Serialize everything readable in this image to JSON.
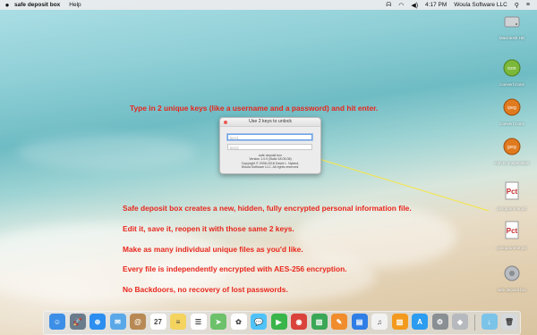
{
  "menubar": {
    "app_name": "safe deposit box",
    "menus": [
      "Help"
    ],
    "time": "4:17 PM",
    "company": "Woula Software LLC"
  },
  "instructions": {
    "top": "Type in 2 unique keys (like a username and a password) and hit enter.",
    "lines": [
      "Safe deposit box creates a new, hidden, fully encrypted personal information file.",
      "Edit it, save it, reopen it with those same 2 keys.",
      "Make as many individual unique files as you'd like.",
      "Every file is independently encrypted with AES-256 encryption.",
      "No Backdoors, no recovery of lost passwords."
    ]
  },
  "dialog": {
    "title": "Use 2 keys to unlock",
    "key1_placeholder": "key1",
    "key2_placeholder": "key2",
    "info_lines": [
      "safe deposit box",
      "Version 1.0.0 (Build 18.05.08)",
      "Copyright © 2008-2018 David L. Nyland,",
      "Woula Software LLC. All rights reserved."
    ]
  },
  "desktop_icons": [
    {
      "label": "Macintosh HD",
      "icon": "hard-drive-icon"
    },
    {
      "label": "iconvert icons",
      "icon": "iconvert-icon"
    },
    {
      "label": "iconvert icons",
      "icon": "ipeg-icon"
    },
    {
      "label": "icon to imagemaker",
      "icon": "jpeg-icon"
    },
    {
      "label": "pictogramme.pct",
      "icon": "pict-icon"
    },
    {
      "label": "pictogramme.pct",
      "icon": "pict-icon"
    },
    {
      "label": "safe deposit box",
      "icon": "safe-icon"
    }
  ],
  "dock": [
    {
      "name": "finder",
      "color": "#3d8ee6",
      "glyph": "☺"
    },
    {
      "name": "launchpad",
      "color": "#6a7c8c",
      "glyph": "🚀"
    },
    {
      "name": "safari",
      "color": "#2b8ef0",
      "glyph": "⊕"
    },
    {
      "name": "mail",
      "color": "#5aa8e8",
      "glyph": "✉"
    },
    {
      "name": "contacts",
      "color": "#b88954",
      "glyph": "@"
    },
    {
      "name": "calendar",
      "color": "#ffffff",
      "glyph": "27"
    },
    {
      "name": "notes",
      "color": "#f4d35e",
      "glyph": "≡"
    },
    {
      "name": "reminders",
      "color": "#ffffff",
      "glyph": "☰"
    },
    {
      "name": "maps",
      "color": "#6cc16a",
      "glyph": "➤"
    },
    {
      "name": "photos",
      "color": "#ffffff",
      "glyph": "✿"
    },
    {
      "name": "messages",
      "color": "#4fc3f7",
      "glyph": "💬"
    },
    {
      "name": "facetime",
      "color": "#39b54a",
      "glyph": "▶"
    },
    {
      "name": "photo-booth",
      "color": "#d9433b",
      "glyph": "◉"
    },
    {
      "name": "numbers",
      "color": "#3aa757",
      "glyph": "▥"
    },
    {
      "name": "pages",
      "color": "#f08c2c",
      "glyph": "✎"
    },
    {
      "name": "keynote",
      "color": "#2f7ee6",
      "glyph": "▤"
    },
    {
      "name": "itunes",
      "color": "#f2f2f2",
      "glyph": "♫"
    },
    {
      "name": "ibooks",
      "color": "#f39a1e",
      "glyph": "▥"
    },
    {
      "name": "app-store",
      "color": "#2c9cf0",
      "glyph": "A"
    },
    {
      "name": "system-preferences",
      "color": "#8a8f94",
      "glyph": "⚙"
    },
    {
      "name": "safe-deposit-box",
      "color": "#b6b9bd",
      "glyph": "◈"
    },
    {
      "name": "downloads",
      "color": "#7cc3e8",
      "glyph": "↓"
    },
    {
      "name": "trash",
      "color": "#d6dadd",
      "glyph": "🗑"
    }
  ]
}
